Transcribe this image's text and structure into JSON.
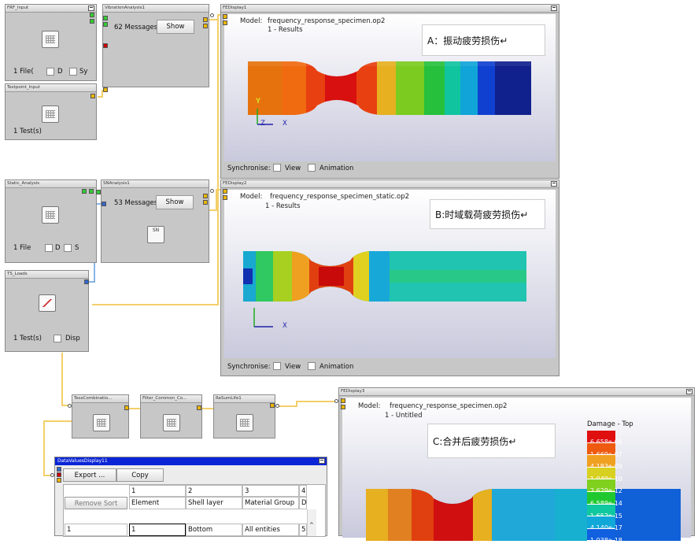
{
  "nodes": {
    "frf_input": {
      "title": "FRF_Input",
      "files": "1 File(",
      "cb1": "D",
      "cb2": "Sy"
    },
    "vibration": {
      "title": "VibrationAnalysis1",
      "messages": "62 Messages",
      "show": "Show"
    },
    "testpoint": {
      "title": "Testpoint_Input",
      "tests": "1 Test(s)"
    },
    "static": {
      "title": "Static_Analysis",
      "files": "1 File",
      "cb1": "D",
      "cb2": "S"
    },
    "sn": {
      "title": "SNAnalysis1",
      "messages": "53 Messages",
      "show": "Show",
      "icon": "SN"
    },
    "ts_loads": {
      "title": "TS_Loads",
      "tests": "1 Test(s)",
      "cb": "Disp"
    },
    "tess_comb": {
      "title": "TessCombinatio..."
    },
    "filter": {
      "title": "Filter_Common_Co..."
    },
    "resum": {
      "title": "ReSumLife1"
    }
  },
  "fe1": {
    "title": "FEDisplay1",
    "model_label": "Model:",
    "model_file": "frequency_response_specimen.op2",
    "results": "1 - Results",
    "note": "A：振动疲劳损伤↵",
    "sync": "Synchronise:",
    "view": "View",
    "animation": "Animation",
    "axis_y": "Y",
    "axis_z": "Z",
    "axis_x": "X"
  },
  "fe2": {
    "title": "FEDisplay2",
    "model_label": "Model:",
    "model_file": "frequency_response_specimen_static.op2",
    "results": "1 - Results",
    "note": "B:时域载荷疲劳损伤↵",
    "sync": "Synchronise:",
    "view": "View",
    "animation": "Animation",
    "axis_x": "X"
  },
  "fe3": {
    "title": "FEDisplay3",
    "model_label": "Model:",
    "model_file": "frequency_response_specimen.op2",
    "results": "1 - Untitled",
    "note": "C:合并后疲劳损伤↵",
    "legend_title": "Damage - Top",
    "legend": [
      {
        "value": "6.658e-06",
        "color": "#e01010"
      },
      {
        "value": "1.669e-07",
        "color": "#ee5a10"
      },
      {
        "value": "4.183e-09",
        "color": "#f0a020"
      },
      {
        "value": "1.049e-10",
        "color": "#d8d020"
      },
      {
        "value": "2.629e-12",
        "color": "#80d020"
      },
      {
        "value": "6.589e-14",
        "color": "#20c830"
      },
      {
        "value": "1.652e-15",
        "color": "#10c8a0"
      },
      {
        "value": "4.140e-17",
        "color": "#10a8d8"
      },
      {
        "value": "1.038e-18",
        "color": "#1060e0"
      }
    ]
  },
  "datavalues": {
    "title": "DataValuesDisplay11",
    "export": "Export ...",
    "copy": "Copy",
    "remove_sort": "Remove Sort",
    "col_nums": [
      "1",
      "2",
      "3",
      "4"
    ],
    "headers": [
      "Element",
      "Shell layer",
      "Material Group",
      "D"
    ],
    "row_index": "1",
    "row": [
      "1",
      "Bottom",
      "All entities",
      "5"
    ]
  },
  "colors": {
    "window_gray": "#c7c7c7",
    "wire": "#f3cf6a",
    "wire_blue": "#8ab4e8",
    "titlebar_blue": "#0a24d6"
  }
}
